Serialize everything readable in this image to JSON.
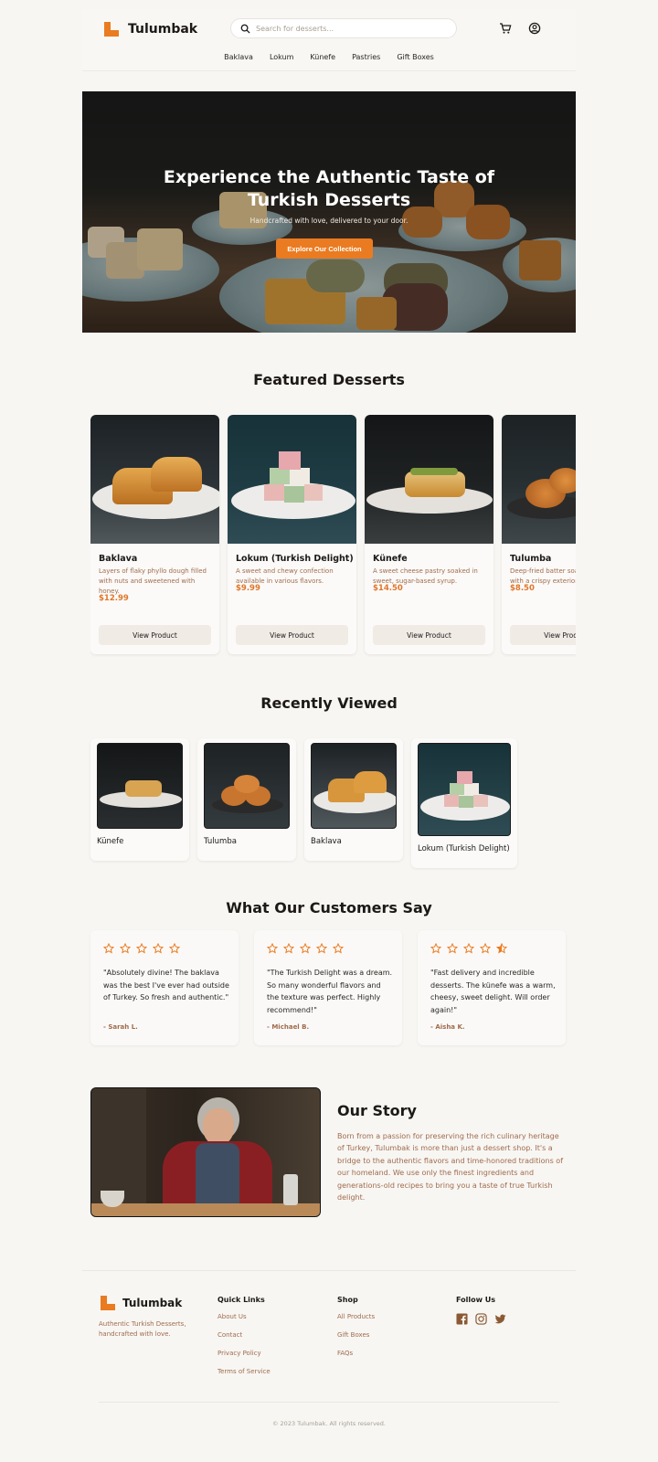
{
  "brand": {
    "name": "Tulumbak",
    "color": "#ea7b21"
  },
  "search": {
    "placeholder": "Search for desserts..."
  },
  "nav": [
    "Baklava",
    "Lokum",
    "Künefe",
    "Pastries",
    "Gift Boxes"
  ],
  "hero": {
    "title": "Experience the Authentic Taste of Turkish Desserts",
    "subtitle": "Handcrafted with love, delivered to your door.",
    "cta": "Explore Our Collection"
  },
  "featured": {
    "title": "Featured Desserts",
    "items": [
      {
        "name": "Baklava",
        "desc": "Layers of flaky phyllo dough filled with nuts and sweetened with honey.",
        "price": "$12.99",
        "button": "View Product"
      },
      {
        "name": "Lokum (Turkish Delight)",
        "desc": "A sweet and chewy confection available in various flavors.",
        "price": "$9.99",
        "button": "View Product"
      },
      {
        "name": "Künefe",
        "desc": "A sweet cheese pastry soaked in sweet, sugar-based syrup.",
        "price": "$14.50",
        "button": "View Product"
      },
      {
        "name": "Tulumba",
        "desc": "Deep-fried batter soaked in syrup, with a crispy exterior.",
        "price": "$8.50",
        "button": "View Product"
      }
    ]
  },
  "recent": {
    "title": "Recently Viewed",
    "items": [
      "Künefe",
      "Tulumba",
      "Baklava",
      "Lokum (Turkish Delight)"
    ]
  },
  "testimonials": {
    "title": "What Our Customers Say",
    "items": [
      {
        "quote": "\"Absolutely divine! The baklava was the best I've ever had outside of Turkey. So fresh and authentic.\"",
        "author": "- Sarah L.",
        "rating": 5
      },
      {
        "quote": "\"The Turkish Delight was a dream. So many wonderful flavors and the texture was perfect. Highly recommend!\"",
        "author": "- Michael B.",
        "rating": 5
      },
      {
        "quote": "\"Fast delivery and incredible desserts. The künefe was a warm, cheesy, sweet delight. Will order again!\"",
        "author": "- Aisha K.",
        "rating": 4.5
      }
    ]
  },
  "story": {
    "title": "Our Story",
    "text": "Born from a passion for preserving the rich culinary heritage of Turkey, Tulumbak is more than just a dessert shop. It's a bridge to the authentic flavors and time-honored traditions of our homeland. We use only the finest ingredients and generations-old recipes to bring you a taste of true Turkish delight."
  },
  "footer": {
    "tagline": "Authentic Turkish Desserts, handcrafted with love.",
    "quick_links": {
      "title": "Quick Links",
      "items": [
        "About Us",
        "Contact",
        "Privacy Policy",
        "Terms of Service"
      ]
    },
    "shop": {
      "title": "Shop",
      "items": [
        "All Products",
        "Gift Boxes",
        "FAQs"
      ]
    },
    "follow": {
      "title": "Follow Us",
      "icons": [
        "facebook-icon",
        "instagram-icon",
        "twitter-icon"
      ]
    },
    "copyright": "© 2023 Tulumbak. All rights reserved."
  }
}
